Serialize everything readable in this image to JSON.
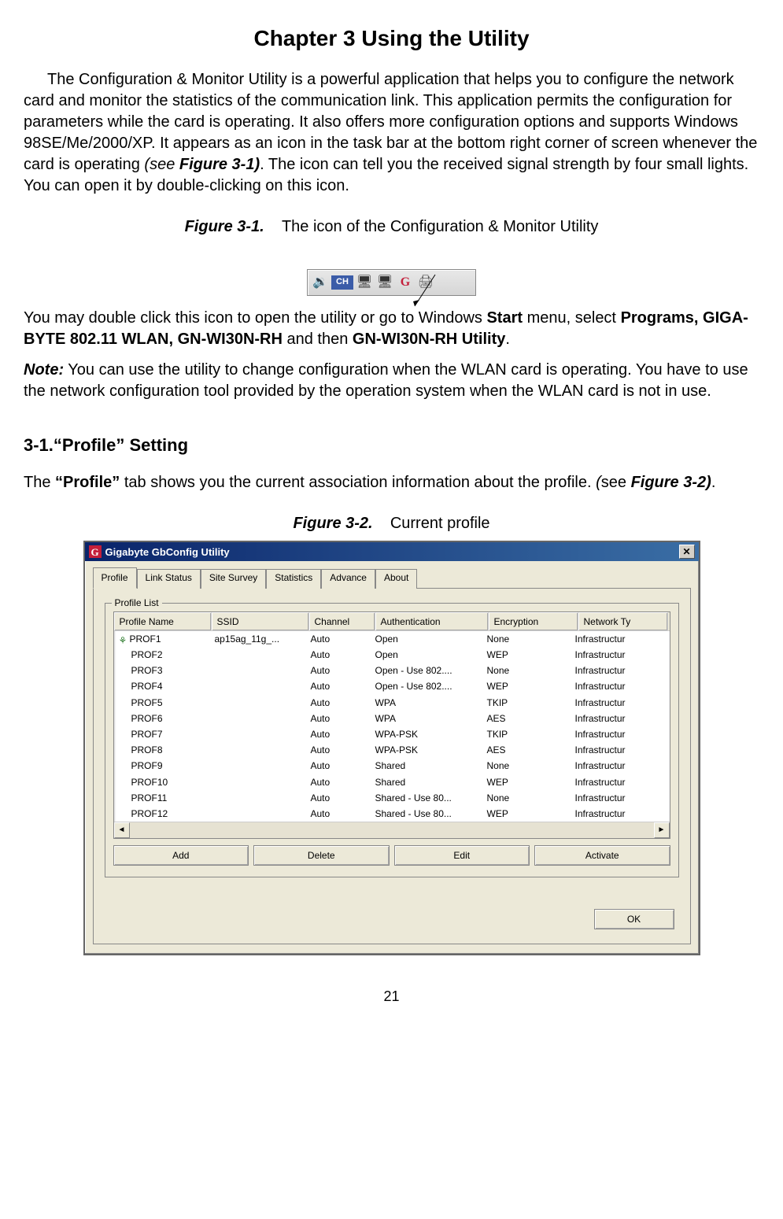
{
  "chapter_title": "Chapter 3    Using the Utility",
  "para1": "The Configuration & Monitor Utility is a powerful application that helps you to configure the network card and monitor the statistics of the communication link. This application permits the configuration for parameters while the card is operating. It also offers more configuration options and supports Windows 98SE/Me/2000/XP. It appears as an icon in the task bar at the bottom right corner of screen whenever the card is operating ",
  "para1_ref_open": "(see ",
  "para1_ref": "Figure 3-1)",
  "para1_tail": ". The icon can tell you the received signal strength by four small lights. You can open it by double-clicking on this icon.",
  "fig31_label": "Figure 3-1.",
  "fig31_text": "The icon of the Configuration & Monitor Utility",
  "tray": {
    "lang": "CH"
  },
  "para2_a": "You may double click this icon to open the utility or go to Windows ",
  "para2_b": "Start",
  "para2_c": " menu, select ",
  "para2_d": "Programs, GIGA-BYTE 802.11 WLAN, GN-WI30N-RH",
  "para2_e": " and then ",
  "para2_f": "GN-WI30N-RH Utility",
  "para2_g": ".",
  "note_label": "Note:",
  "note_text": " You can use the utility to change configuration when the WLAN card is operating. You have to use the network configuration tool provided by the operation system when the WLAN card is not in use.",
  "section_heading": "3-1.“Profile” Setting",
  "para3_a": "The ",
  "para3_b": "“Profile”",
  "para3_c": " tab shows you the current association information about the profile. ",
  "para3_d": "(",
  "para3_e": "see ",
  "para3_f": "Figure 3-2)",
  "para3_g": ".",
  "fig32_label": "Figure 3-2.",
  "fig32_text": "Current profile",
  "dialog": {
    "title": "Gigabyte GbConfig Utility",
    "tabs": [
      "Profile",
      "Link Status",
      "Site Survey",
      "Statistics",
      "Advance",
      "About"
    ],
    "group_label": "Profile List",
    "columns": [
      "Profile Name",
      "SSID",
      "Channel",
      "Authentication",
      "Encryption",
      "Network Ty"
    ],
    "rows": [
      {
        "active": true,
        "name": "PROF1",
        "ssid": "ap15ag_11g_...",
        "chan": "Auto",
        "auth": "Open",
        "enc": "None",
        "net": "Infrastructur"
      },
      {
        "active": false,
        "name": "PROF2",
        "ssid": "",
        "chan": "Auto",
        "auth": "Open",
        "enc": "WEP",
        "net": "Infrastructur"
      },
      {
        "active": false,
        "name": "PROF3",
        "ssid": "",
        "chan": "Auto",
        "auth": "Open - Use 802....",
        "enc": "None",
        "net": "Infrastructur"
      },
      {
        "active": false,
        "name": "PROF4",
        "ssid": "",
        "chan": "Auto",
        "auth": "Open - Use 802....",
        "enc": "WEP",
        "net": "Infrastructur"
      },
      {
        "active": false,
        "name": "PROF5",
        "ssid": "",
        "chan": "Auto",
        "auth": "WPA",
        "enc": "TKIP",
        "net": "Infrastructur"
      },
      {
        "active": false,
        "name": "PROF6",
        "ssid": "",
        "chan": "Auto",
        "auth": "WPA",
        "enc": "AES",
        "net": "Infrastructur"
      },
      {
        "active": false,
        "name": "PROF7",
        "ssid": "",
        "chan": "Auto",
        "auth": "WPA-PSK",
        "enc": "TKIP",
        "net": "Infrastructur"
      },
      {
        "active": false,
        "name": "PROF8",
        "ssid": "",
        "chan": "Auto",
        "auth": "WPA-PSK",
        "enc": "AES",
        "net": "Infrastructur"
      },
      {
        "active": false,
        "name": "PROF9",
        "ssid": "",
        "chan": "Auto",
        "auth": "Shared",
        "enc": "None",
        "net": "Infrastructur"
      },
      {
        "active": false,
        "name": "PROF10",
        "ssid": "",
        "chan": "Auto",
        "auth": "Shared",
        "enc": "WEP",
        "net": "Infrastructur"
      },
      {
        "active": false,
        "name": "PROF11",
        "ssid": "",
        "chan": "Auto",
        "auth": "Shared - Use 80...",
        "enc": "None",
        "net": "Infrastructur"
      },
      {
        "active": false,
        "name": "PROF12",
        "ssid": "",
        "chan": "Auto",
        "auth": "Shared - Use 80...",
        "enc": "WEP",
        "net": "Infrastructur"
      }
    ],
    "buttons": {
      "add": "Add",
      "delete": "Delete",
      "edit": "Edit",
      "activate": "Activate",
      "ok": "OK"
    }
  },
  "page_number": "21"
}
